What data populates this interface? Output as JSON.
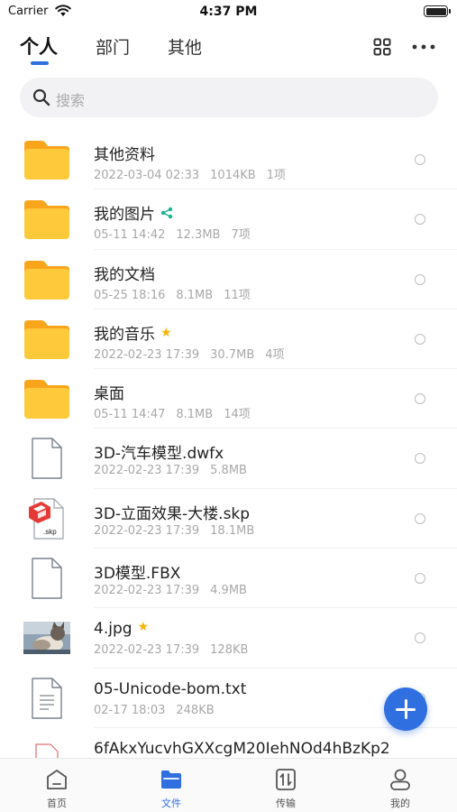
{
  "status_bar": {
    "carrier": "Carrier",
    "time": "4:37 PM"
  },
  "tabs": [
    {
      "label": "个人",
      "active": true
    },
    {
      "label": "部门",
      "active": false
    },
    {
      "label": "其他",
      "active": false
    }
  ],
  "search": {
    "placeholder": "搜索"
  },
  "files": [
    {
      "name": "其他资料",
      "type": "folder",
      "meta": [
        "2022-03-04 02:33",
        "1014KB",
        "1项"
      ],
      "badge": ""
    },
    {
      "name": "我的图片",
      "type": "folder",
      "meta": [
        "05-11 14:42",
        "12.3MB",
        "7项"
      ],
      "badge": "share-icon"
    },
    {
      "name": "我的文档",
      "type": "folder",
      "meta": [
        "05-25 18:16",
        "8.1MB",
        "11项"
      ],
      "badge": ""
    },
    {
      "name": "我的音乐",
      "type": "folder",
      "meta": [
        "2022-02-23 17:39",
        "30.7MB",
        "4项"
      ],
      "badge": "star-icon"
    },
    {
      "name": "桌面",
      "type": "folder",
      "meta": [
        "05-11 14:47",
        "8.1MB",
        "14项"
      ],
      "badge": ""
    },
    {
      "name": "3D-汽车模型.dwfx",
      "type": "doc",
      "meta": [
        "2022-02-23 17:39",
        "5.8MB"
      ],
      "badge": ""
    },
    {
      "name": "3D-立面效果-大楼.skp",
      "type": "skp",
      "meta": [
        "2022-02-23 17:39",
        "18.1MB"
      ],
      "badge": "",
      "thumb_label": ".skp"
    },
    {
      "name": "3D模型.FBX",
      "type": "doc",
      "meta": [
        "2022-02-23 17:39",
        "4.9MB"
      ],
      "badge": ""
    },
    {
      "name": "4.jpg",
      "type": "image",
      "meta": [
        "2022-02-23 17:39",
        "128KB"
      ],
      "badge": "star-icon"
    },
    {
      "name": "05-Unicode-bom.txt",
      "type": "txt",
      "meta": [
        "02-17 18:03",
        "248KB"
      ],
      "badge": ""
    },
    {
      "name": "6fAkxYucvhGXXcgM20IehNOd4hBzKp2",
      "type": "other",
      "meta": [],
      "badge": ""
    }
  ],
  "bottom_nav": [
    {
      "label": "首页",
      "icon": "home-icon",
      "active": false
    },
    {
      "label": "文件",
      "icon": "folder-icon",
      "active": true
    },
    {
      "label": "传输",
      "icon": "transfer-icon",
      "active": false
    },
    {
      "label": "我的",
      "icon": "profile-icon",
      "active": false
    }
  ],
  "colors": {
    "accent": "#2f6fe0",
    "folder": "#ffc93c",
    "folder_tab": "#f8a51c",
    "star": "#f5b400",
    "share": "#19b393"
  }
}
